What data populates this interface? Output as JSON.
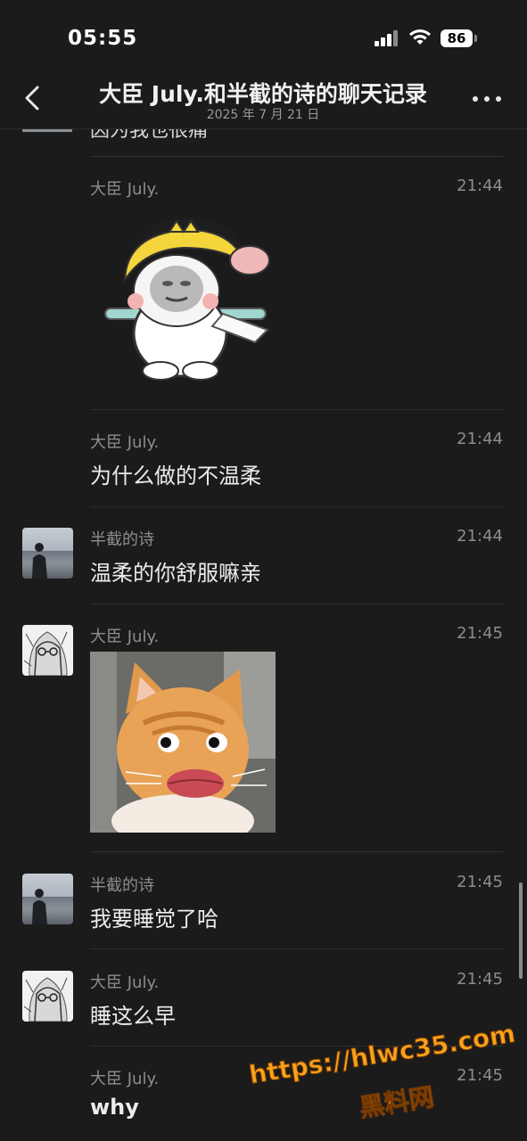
{
  "status_bar": {
    "time": "05:55",
    "battery": "86",
    "icons": [
      "signal-icon",
      "wifi-icon",
      "battery-icon"
    ]
  },
  "header": {
    "title": "大臣 July.和半截的诗的聊天记录",
    "subtitle": "2025 年 7 月 21 日",
    "back_icon": "chevron-left-icon",
    "more_icon": "more-dots-icon"
  },
  "partial_message": {
    "text": "因为我也很痛"
  },
  "messages": [
    {
      "sender": "大臣 July.",
      "time": "21:44",
      "type": "sticker"
    },
    {
      "sender": "大臣 July.",
      "time": "21:44",
      "type": "text",
      "text": "为什么做的不温柔"
    },
    {
      "sender": "半截的诗",
      "time": "21:44",
      "type": "text",
      "text": "温柔的你舒服嘛亲"
    },
    {
      "sender": "大臣 July.",
      "time": "21:45",
      "type": "image"
    },
    {
      "sender": "半截的诗",
      "time": "21:45",
      "type": "text",
      "text": "我要睡觉了哈"
    },
    {
      "sender": "大臣 July.",
      "time": "21:45",
      "type": "text",
      "text": "睡这么早"
    },
    {
      "sender": "大臣 July.",
      "time": "21:45",
      "type": "text",
      "text": "why"
    }
  ],
  "watermark": {
    "url": "https://hlwc35.com",
    "name": "黑料网"
  },
  "colors": {
    "background": "#1b1b1b",
    "meta_text": "#8d8d8d",
    "watermark": "#f6a21c"
  }
}
